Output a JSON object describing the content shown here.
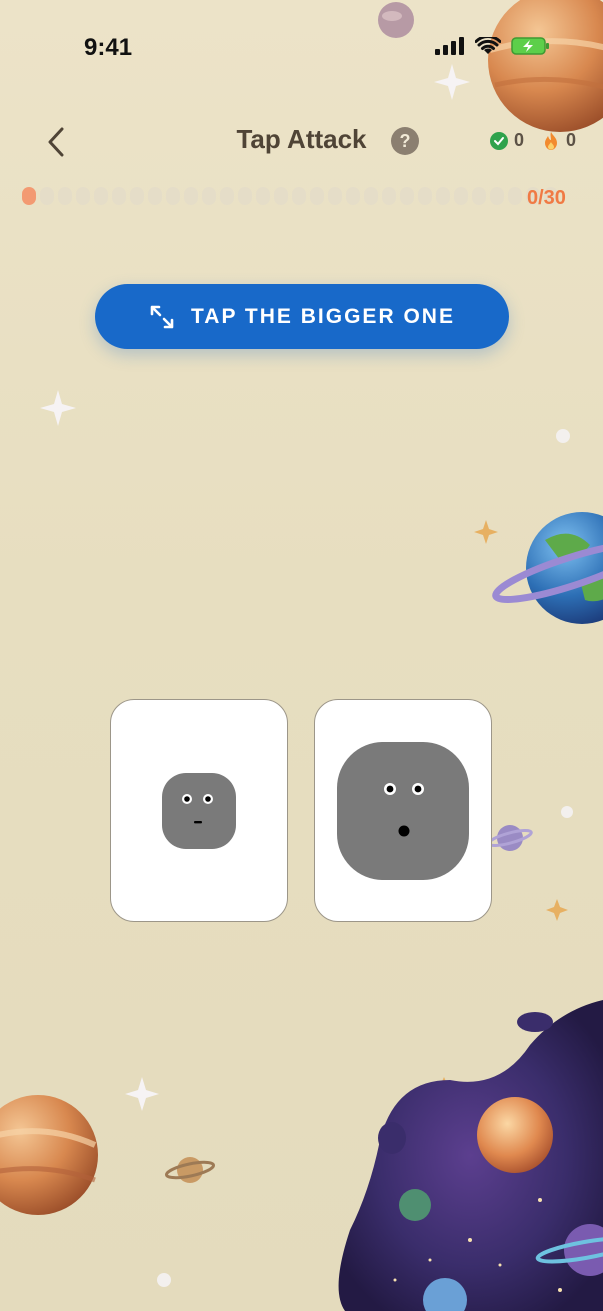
{
  "status_bar": {
    "time": "9:41"
  },
  "header": {
    "title": "Tap Attack",
    "help_label": "?",
    "correct_count": "0",
    "streak_count": "0"
  },
  "progress": {
    "current": 0,
    "total": 30,
    "label": "0/30"
  },
  "instruction": {
    "text": "TAP THE BIGGER ONE",
    "icon": "expand-arrows-icon"
  },
  "colors": {
    "background": "#e8dfc3",
    "instruction_bg": "#1869c9",
    "progress_active": "#f39a72",
    "progress_label": "#f07a44",
    "shape_gray": "#7a7a7a",
    "correct_green": "#2fa24c",
    "streak_orange": "#f28a2e"
  },
  "cards": [
    {
      "id": "left",
      "size": "small",
      "expression": "neutral"
    },
    {
      "id": "right",
      "size": "large",
      "expression": "surprised"
    }
  ]
}
